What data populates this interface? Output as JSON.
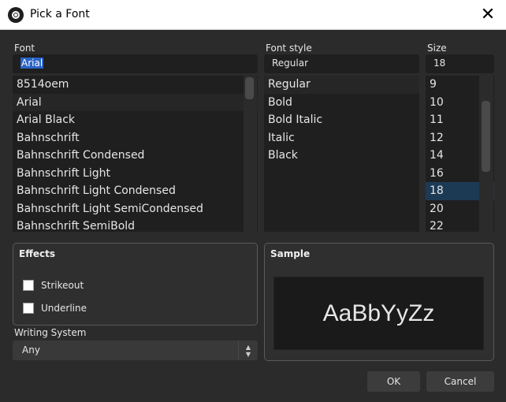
{
  "window": {
    "title": "Pick a Font",
    "close_glyph": "✕"
  },
  "font": {
    "label": "Font",
    "input_value": "Arial",
    "items": [
      "8514oem",
      "Arial",
      "Arial Black",
      "Bahnschrift",
      "Bahnschrift Condensed",
      "Bahnschrift Light",
      "Bahnschrift Light Condensed",
      "Bahnschrift Light SemiCondensed",
      "Bahnschrift SemiBold"
    ]
  },
  "font_style": {
    "label": "Font style",
    "input_value": "Regular",
    "items": [
      "Regular",
      "Bold",
      "Bold Italic",
      "Italic",
      "Black"
    ]
  },
  "size": {
    "label": "Size",
    "input_value": "18",
    "items": [
      "9",
      "10",
      "11",
      "12",
      "14",
      "16",
      "18",
      "20",
      "22"
    ]
  },
  "effects": {
    "title": "Effects",
    "strikeout_label": "Strikeout",
    "underline_label": "Underline"
  },
  "sample": {
    "title": "Sample",
    "text": "AaBbYyZz"
  },
  "writing_system": {
    "label": "Writing System",
    "value": "Any"
  },
  "buttons": {
    "ok": "OK",
    "cancel": "Cancel"
  },
  "colors": {
    "background": "#2b2b2b",
    "selection": "#2a63c6",
    "list_selected": "#1d3a55"
  }
}
